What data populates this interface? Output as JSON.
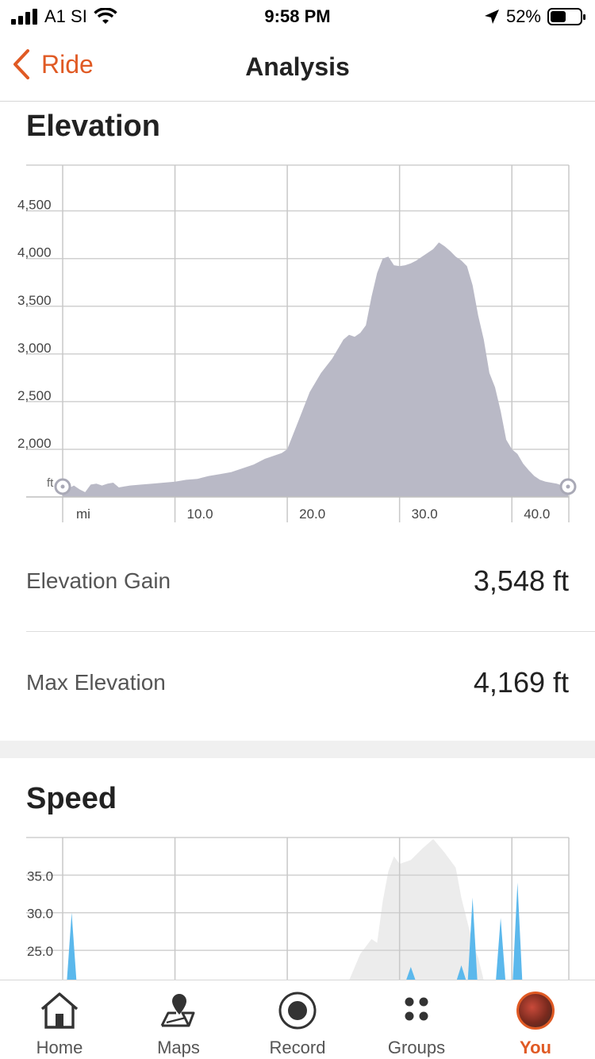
{
  "status_bar": {
    "carrier": "A1 SI",
    "time": "9:58 PM",
    "battery": "52%",
    "battery_level": 0.52
  },
  "nav": {
    "back_label": "Ride",
    "title": "Analysis"
  },
  "elevation": {
    "title": "Elevation",
    "gain_label": "Elevation Gain",
    "gain_value": "3,548 ft",
    "max_label": "Max Elevation",
    "max_value": "4,169 ft"
  },
  "speed": {
    "title": "Speed"
  },
  "chart_data": [
    {
      "type": "area",
      "name": "elevation-chart",
      "yunit": "ft",
      "xunit": "mi",
      "xlim": [
        0,
        45
      ],
      "ylim": [
        1500,
        4980
      ],
      "y_ticks": [
        "4,500",
        "4,000",
        "3,500",
        "3,000",
        "2,500",
        "2,000"
      ],
      "y_tick_values": [
        4500,
        4000,
        3500,
        3000,
        2500,
        2000
      ],
      "x_ticks": [
        "10.0",
        "20.0",
        "30.0",
        "40.0"
      ],
      "x_tick_values": [
        10,
        20,
        30,
        40
      ],
      "grid": true,
      "fill_color": "#b9b9c6",
      "x": [
        0,
        0.5,
        1.0,
        1.5,
        2.0,
        2.5,
        3.0,
        3.5,
        4.0,
        4.5,
        5.0,
        5.5,
        6.0,
        7.0,
        8.0,
        9.0,
        10.0,
        11.0,
        12.0,
        13.0,
        14.0,
        15.0,
        16.0,
        17.0,
        18.0,
        19.0,
        19.5,
        20.0,
        21.0,
        22.0,
        23.0,
        24.0,
        24.5,
        25.0,
        25.5,
        26.0,
        26.5,
        27.0,
        27.5,
        28.0,
        28.5,
        29.0,
        29.5,
        30.0,
        30.5,
        31.0,
        31.5,
        32.0,
        32.5,
        33.0,
        33.5,
        34.0,
        34.5,
        35.0,
        35.5,
        36.0,
        36.5,
        37.0,
        37.5,
        38.0,
        38.5,
        39.0,
        39.5,
        40.0,
        40.5,
        41.0,
        41.5,
        42.0,
        42.5,
        43.0,
        43.5,
        44.0,
        44.5,
        45.0
      ],
      "y": [
        1570,
        1590,
        1620,
        1580,
        1550,
        1630,
        1640,
        1620,
        1640,
        1650,
        1600,
        1610,
        1620,
        1630,
        1640,
        1650,
        1660,
        1680,
        1690,
        1720,
        1740,
        1760,
        1800,
        1840,
        1900,
        1940,
        1960,
        2000,
        2300,
        2600,
        2800,
        2950,
        3050,
        3150,
        3200,
        3180,
        3220,
        3300,
        3600,
        3850,
        4000,
        4020,
        3930,
        3920,
        3930,
        3950,
        3980,
        4020,
        4060,
        4100,
        4169,
        4130,
        4080,
        4020,
        3980,
        3920,
        3720,
        3400,
        3150,
        2800,
        2650,
        2400,
        2100,
        2000,
        1950,
        1850,
        1780,
        1720,
        1680,
        1660,
        1650,
        1640,
        1620,
        1600
      ]
    },
    {
      "type": "area",
      "name": "speed-chart",
      "xlim": [
        0,
        45
      ],
      "ylim": [
        21,
        40
      ],
      "y_ticks": [
        "35.0",
        "30.0",
        "25.0"
      ],
      "y_tick_values": [
        35,
        30,
        25
      ],
      "grid": true,
      "series": [
        {
          "kind": "elevation-overlay",
          "color": "#ececec",
          "x": [
            25.5,
            26.5,
            27.5,
            28.0,
            28.5,
            29.0,
            29.5,
            30.0,
            31.0,
            32.0,
            33.0,
            34.0,
            35.0,
            35.5,
            36.0,
            36.5,
            37.0,
            37.5
          ],
          "y": [
            21,
            24.5,
            26.5,
            26.0,
            31.5,
            35.5,
            37.5,
            36.5,
            37.0,
            38.5,
            39.8,
            38.0,
            36.0,
            32.0,
            29.0,
            26.0,
            24.0,
            21
          ]
        },
        {
          "kind": "speed",
          "color": "#5bb8ec",
          "spikes": [
            {
              "x": 0.8,
              "peak": 30.0
            },
            {
              "x": 31.0,
              "peak": 22.8
            },
            {
              "x": 35.5,
              "peak": 23.0
            },
            {
              "x": 36.5,
              "peak": 32.0
            },
            {
              "x": 39.0,
              "peak": 29.3
            },
            {
              "x": 40.5,
              "peak": 34.0
            }
          ]
        }
      ]
    }
  ],
  "tabs": [
    {
      "label": "Home",
      "icon": "home-icon",
      "active": false
    },
    {
      "label": "Maps",
      "icon": "maps-icon",
      "active": false
    },
    {
      "label": "Record",
      "icon": "record-icon",
      "active": false
    },
    {
      "label": "Groups",
      "icon": "groups-icon",
      "active": false
    },
    {
      "label": "You",
      "icon": "avatar",
      "active": true
    }
  ],
  "colors": {
    "accent": "#e05a24",
    "elevation_fill": "#b9b9c6",
    "speed_fill": "#5bb8ec"
  }
}
